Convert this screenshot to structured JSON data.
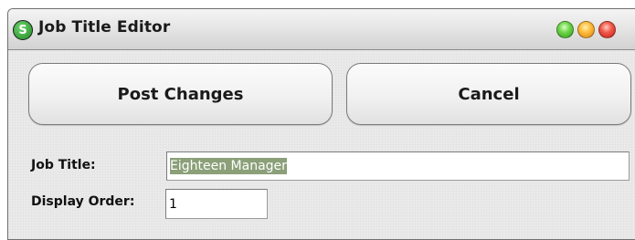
{
  "window": {
    "title": "Job Title Editor",
    "app_icon_letter": "S",
    "controls": [
      "maximize",
      "minimize",
      "close"
    ],
    "colors": {
      "control_green": "#4fbf35",
      "control_yellow": "#ffb02e",
      "control_red": "#e8423a",
      "selection": "#8ba079"
    }
  },
  "toolbar": {
    "post_label": "Post Changes",
    "cancel_label": "Cancel"
  },
  "form": {
    "job_title_label": "Job Title:",
    "job_title_value": "Eighteen Manager",
    "display_order_label": "Display Order:",
    "display_order_value": "1"
  }
}
